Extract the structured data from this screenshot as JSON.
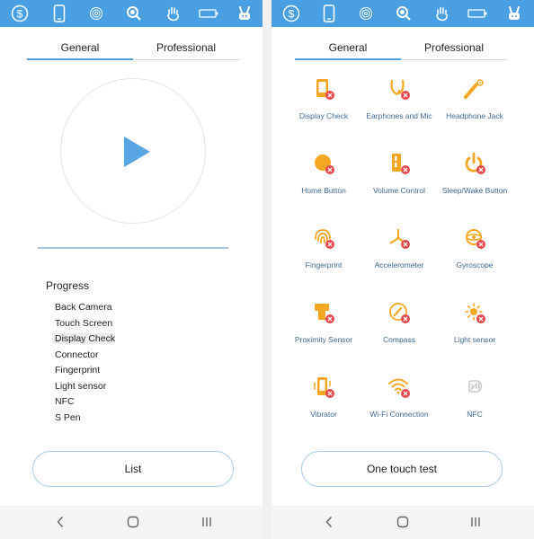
{
  "colors": {
    "accent": "#4a9fe2",
    "icon_orange": "#f5a623",
    "badge_red": "#e8474b",
    "label_blue": "#3d6a92"
  },
  "status_icons": [
    "dollar-circle-icon",
    "phone-icon",
    "fingerprint-icon",
    "magnifier-icon",
    "hand-icon",
    "battery-icon",
    "bunny-icon"
  ],
  "left_panel": {
    "tabs": {
      "general": "General",
      "professional": "Professional",
      "active": "general"
    },
    "progress": {
      "title": "Progress",
      "items": [
        "Back Camera",
        "Touch Screen",
        "Display Check",
        "Connector",
        "Fingerprint",
        "Light sensor",
        "NFC",
        "S Pen"
      ]
    },
    "action_button": "List"
  },
  "right_panel": {
    "tabs": {
      "general": "General",
      "professional": "Professional",
      "active": "general"
    },
    "tests": [
      {
        "label": "Display Check",
        "icon": "display-icon",
        "status": "failed"
      },
      {
        "label": "Earphones and Mic",
        "icon": "earphones-icon",
        "status": "failed"
      },
      {
        "label": "Headphone Jack",
        "icon": "headphone-jack-icon",
        "status": "failed"
      },
      {
        "label": "Home Button",
        "icon": "home-button-icon",
        "status": "failed"
      },
      {
        "label": "Volume Control",
        "icon": "volume-control-icon",
        "status": "failed"
      },
      {
        "label": "Sleep/Wake Button",
        "icon": "power-icon",
        "status": "failed"
      },
      {
        "label": "Fingerprint",
        "icon": "fingerprint-icon",
        "status": "failed"
      },
      {
        "label": "Accelerometer",
        "icon": "accelerometer-icon",
        "status": "failed"
      },
      {
        "label": "Gyroscope",
        "icon": "gyroscope-icon",
        "status": "failed"
      },
      {
        "label": "Proximity Sensor",
        "icon": "proximity-sensor-icon",
        "status": "failed"
      },
      {
        "label": "Compass",
        "icon": "compass-icon",
        "status": "failed"
      },
      {
        "label": "Light sensor",
        "icon": "light-sensor-icon",
        "status": "failed"
      },
      {
        "label": "Vibrator",
        "icon": "vibrator-icon",
        "status": "failed"
      },
      {
        "label": "Wi-Fi Connection",
        "icon": "wifi-icon",
        "status": "failed"
      },
      {
        "label": "NFC",
        "icon": "nfc-icon",
        "status": "unsupported"
      }
    ],
    "action_button": "One touch test"
  },
  "navbar": [
    "back-icon",
    "home-icon",
    "recents-icon"
  ]
}
